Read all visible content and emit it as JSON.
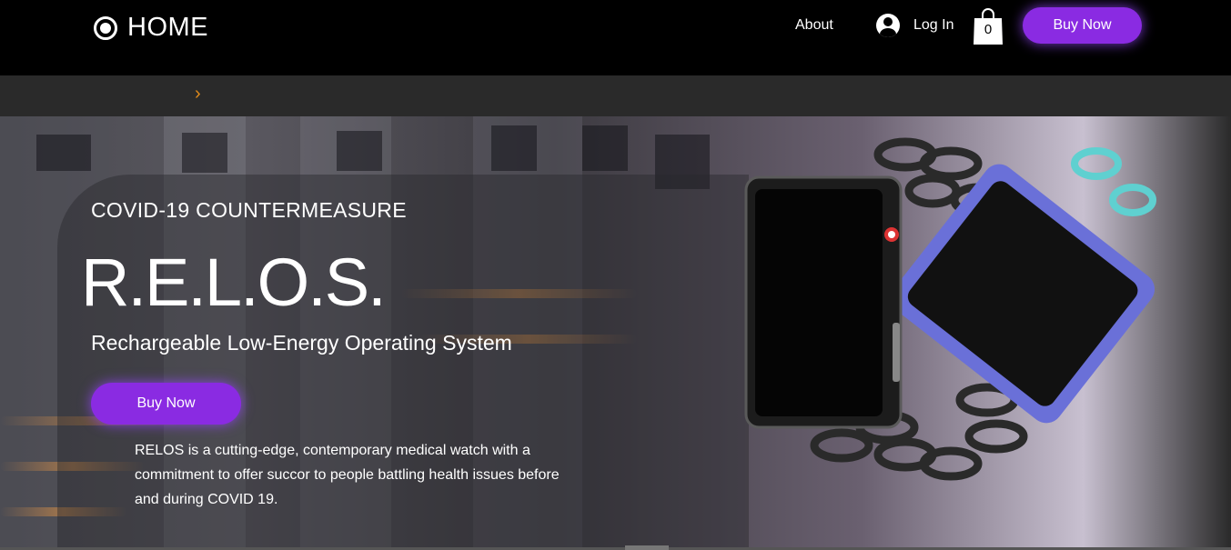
{
  "header": {
    "logo_text": "HOME",
    "nav_about": "About",
    "login_label": "Log In",
    "cart_count": "0",
    "buy_button": "Buy Now"
  },
  "subbar": {
    "chevron": "›"
  },
  "hero": {
    "eyebrow": "COVID-19 COUNTERMEASURE",
    "headline": "R.E.L.O.S.",
    "subtitle": "Rechargeable Low-Energy Operating System",
    "buy_button": "Buy Now",
    "description": "RELOS is a cutting-edge, contemporary medical watch with a commitment to offer succor to people battling health issues before and during COVID 19."
  },
  "colors": {
    "accent": "#8a2be2",
    "header_bg": "#000000",
    "subbar_bg": "#2a2a2a",
    "chevron": "#e08a1a"
  },
  "icons": [
    "logo-circle-icon",
    "user-icon",
    "shopping-bag-icon",
    "chevron-right-icon"
  ]
}
